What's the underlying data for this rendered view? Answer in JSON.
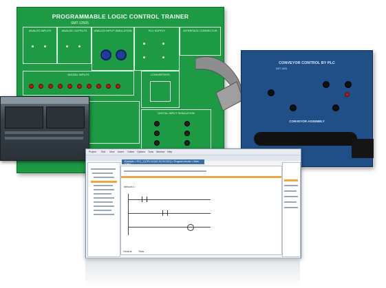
{
  "board": {
    "title": "PROGRAMMABLE LOGIC CONTROL TRAINER",
    "model": "SMT-12505",
    "sections": [
      "ANALOG INPUTS",
      "ANALOG OUTPUTS",
      "ANALOG INPUT SIMULATION",
      "PLC SUPPLY",
      "INTERFACE CONNECTOR",
      "DIGITAL INPUTS",
      "CONVERTERS",
      "DIGITAL INPUT SIMULATION"
    ]
  },
  "conveyor": {
    "title": "CONVEYOR CONTROL BY PLC",
    "model": "SMT-1505",
    "assembly": "CONVEYOR ASSEMBLY"
  },
  "software": {
    "menu": [
      "Project",
      "Edit",
      "View",
      "Insert",
      "Online",
      "Options",
      "Tools",
      "Window",
      "Help"
    ],
    "tab_label": "Example > PLC_1 [CPU 1214C DC/DC/DC] > Program blocks > Main [OB1]",
    "network_label": "Network 1:",
    "bottom_tabs": [
      "General",
      "Texts"
    ]
  },
  "colors": {
    "board_green": "#1e9a45",
    "conveyor_blue": "#1f4f86",
    "led_red": "#b01c10",
    "knob_blue": "#1c3f9e"
  }
}
